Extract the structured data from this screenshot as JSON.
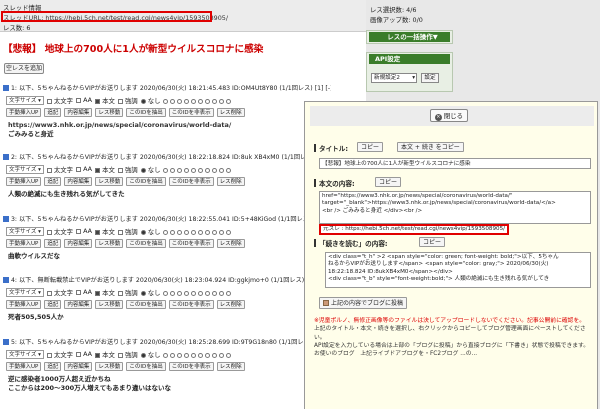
{
  "header": {
    "title": "スレッド情報",
    "url_line": "スレッドURL: https://hebi.5ch.net/test/read.cgi/news4vip/1593508905/",
    "res_count": "レス数: 6"
  },
  "thread_title": "【悲報】 地球上の700人に1人が新型ウイルスコロナに感染",
  "add_button": "空レスを追加",
  "controls": {
    "font_select": "文字サイズ",
    "bold": "太文字",
    "aa": "AA",
    "body": "本文",
    "emph": "強調",
    "emph_none": "なし",
    "btn1": "手動挿入UP",
    "btn2": "追記",
    "btn3": "内容編集",
    "btn4": "レス移動",
    "btn5": "このIDを抽出",
    "btn6": "このIDを非表示",
    "btn7": "レス削除"
  },
  "posts": [
    {
      "head": "1: 以下、5ちゃんねるからVIPがお送りします 2020/06/30(火) 18:21:45.483 ID:OM4Ut8Y80 (1/1回レス) [1] [-]",
      "line1": "https://www3.nhk.or.jp/news/special/coronavirus/world-data/",
      "line2": "ごみみると身近"
    },
    {
      "head": "2: 以下、5ちゃんねるからVIPがお送りします 2020/06/30(火) 18:22:18.824 ID:8uk XB4xM0 (1/1回レス) [2] [-]",
      "line1": "人類の絶滅にも生き残れる気がしてきた",
      "line2": ""
    },
    {
      "head": "3: 以下、5ちゃんねるからVIPがお送りします 2020/06/30(火) 18:22:55.041 ID:5+48KiGod (1/1回レス) [3] [-]",
      "line1": "曲軟ウイルスだな",
      "line2": ""
    },
    {
      "head": "4: 以下、無断転載禁止でVIPがお送りします 2020/06/30(火) 18:23:04.924 ID:ggkjmo+0 (1/1回レス) [4] [-]",
      "line1": "死者505,505人か",
      "line2": ""
    },
    {
      "head": "5: 以下、5ちゃんねるからVIPがお送りします 2020/06/30(火) 18:25:28.699 ID:9T9G18n80 (1/1回レス) [5] [-]",
      "line1": "逆に感染者1000万人超え近かちね",
      "line2": "ここからは200〜300万人増えてもあまり違いはないな"
    }
  ],
  "sidebar": {
    "select_count": "レス選択数: 4/6",
    "image_count": "画像アップ数: 0/0",
    "batch_header": "レスの一括操作▼",
    "api_header": "API設定",
    "api_select": "新規設定2",
    "api_button": "設定"
  },
  "modal": {
    "close": "閉じる",
    "title_label": "タイトル:",
    "copy": "コピー",
    "copy_with_body": "本文 + 続き をコピー",
    "title_value": "【悲報】地球上の700人に1人が新型ウイルスコロナに感染",
    "body_label": "本文の内容:",
    "body_text_1": "href=\"https://www3.nhk.or.jp/news/special/coronavirus/world-data/\"",
    "body_text_2": "target=\"_blank\">https://www3.nhk.or.jp/news/special/coronavirus/world-data/</a>",
    "body_text_3": "<br /> ごみみると身近 </div><br />",
    "source_line": "元スレ : https://hebi.5ch.net/test/read.cgi/news4vip/1593508905/",
    "more_label": "「続きを読む」の内容:",
    "more_text_1": "<div class=\"t_h\" >2 <span style=\"color: green; font-weight: bold;\">以下、5ちゃん",
    "more_text_2": "ねるからVIPがお送りします</span> <span style=\"color: gray;\"> 2020/06/30(火)",
    "more_text_3": "18:22:18.824 ID:8ukXB4xM0</span></div>",
    "more_text_4": "<div class=\"t_b\" style=\"font-weight:bold;\">  人類の絶滅にも生き残れる気がしてき",
    "post_blog": "上記の内容でブログに投稿",
    "notice_1": "※児童ポルノ、無修正画像等のファイルは決してアップロードしないでください。記事公開前に確認を。",
    "notice_2": "上記のタイトル・本文・続きを選択し、右クリックからコピーしてブログ管理画面にペーストしてください。",
    "notice_3": "API設定を入力している場合は上部の「ブログに投稿」から直接ブログに「下書き」状態で投稿できます。",
    "notice_4": "お使いのブログ　上記ライブドアブログを・FC2ブログ ...の..."
  },
  "colors": {
    "accent_red": "#e00000",
    "green_header": "#3a7d2a",
    "modal_bg": "#fffeea"
  }
}
